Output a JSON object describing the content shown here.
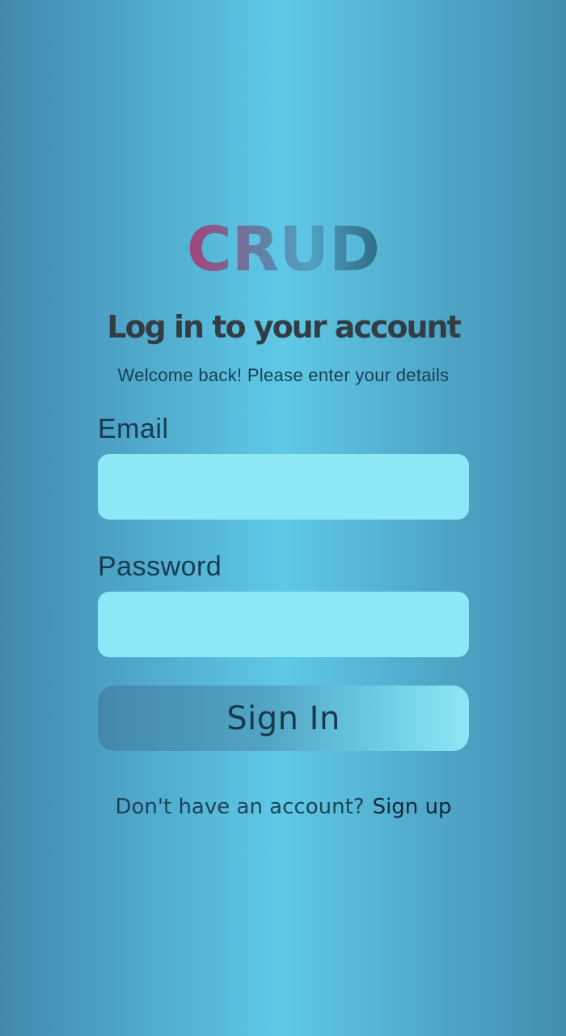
{
  "brand": {
    "logo_text": "CRUD",
    "gradient_colors": [
      "#a3437a",
      "#5f84a8",
      "#52a2c2",
      "#2d6b87"
    ]
  },
  "login": {
    "title": "Log in to your account",
    "subtitle": "Welcome back! Please enter your details",
    "email_label": "Email",
    "email_value": "",
    "password_label": "Password",
    "password_value": "",
    "submit_label": "Sign In"
  },
  "footer": {
    "prompt_text": "Don't have an account?",
    "signup_link_label": "Sign up"
  },
  "colors": {
    "input_background": "#8de7f6",
    "text_dark": "#173c50",
    "title": "#333d44"
  }
}
